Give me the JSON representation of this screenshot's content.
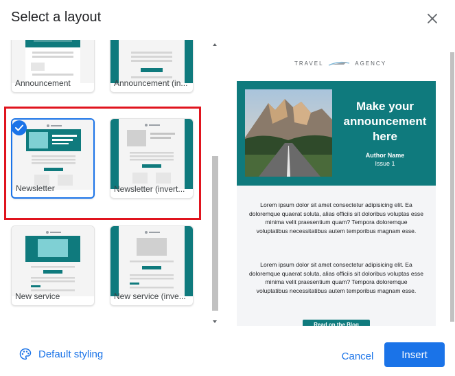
{
  "dialog": {
    "title": "Select a layout",
    "close_icon": "close-icon"
  },
  "layouts": [
    {
      "label": "Announcement",
      "selected": false
    },
    {
      "label": "Announcement (in...",
      "selected": false
    },
    {
      "label": "Newsletter",
      "selected": true
    },
    {
      "label": "Newsletter (invert...",
      "selected": false
    },
    {
      "label": "New service",
      "selected": false
    },
    {
      "label": "New service (inve...",
      "selected": false
    }
  ],
  "preview": {
    "logo_left": "TRAVEL",
    "logo_right": "AGENCY",
    "headline": "Make your announcement here",
    "author": "Author Name",
    "issue": "Issue 1",
    "paragraph_1": "Lorem ipsum dolor sit amet consectetur adipisicing elit. Ea doloremque quaerat soluta, alias officiis sit doloribus voluptas esse minima velit praesentium quam? Tempora doloremque voluptatibus necessitatibus autem temporibus magnam esse.",
    "paragraph_2": "Lorem ipsum dolor sit amet consectetur adipisicing elit. Ea doloremque quaerat soluta, alias officiis sit doloribus voluptas esse minima velit praesentium quam? Tempora doloremque voluptatibus necessitatibus autem temporibus magnam esse.",
    "button_label": "Read on the Blog"
  },
  "footer": {
    "default_styling_label": "Default styling",
    "cancel_label": "Cancel",
    "insert_label": "Insert"
  },
  "colors": {
    "accent": "#1a73e8",
    "teal": "#0f7a7d",
    "highlight_red": "#e0141e"
  }
}
